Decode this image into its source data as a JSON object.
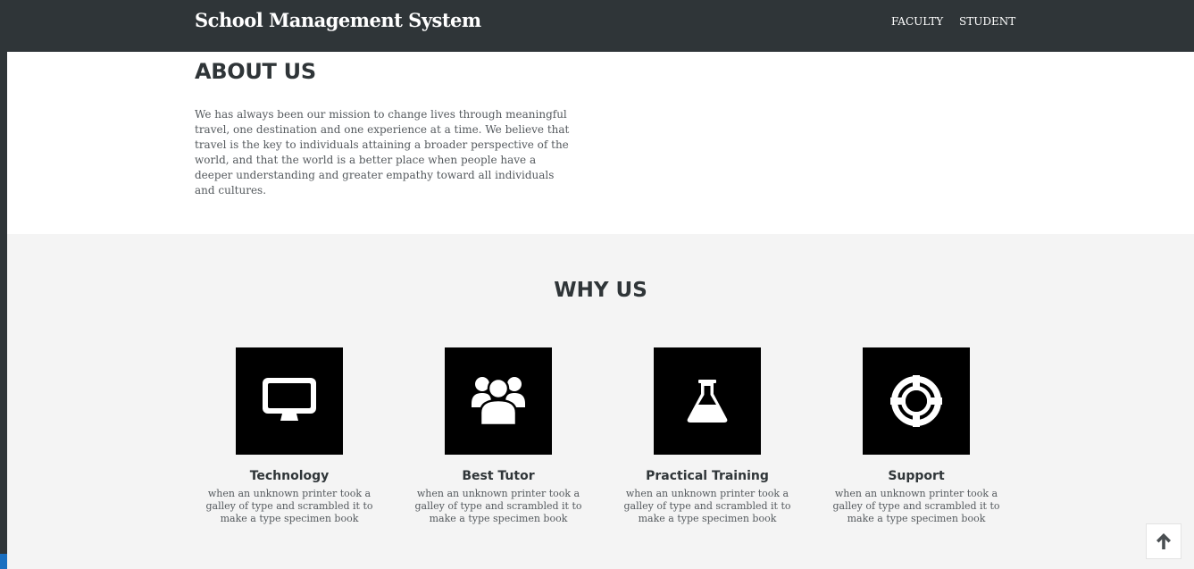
{
  "navbar": {
    "brand": "School Management System",
    "links": [
      {
        "label": "FACULTY"
      },
      {
        "label": "STUDENT"
      }
    ]
  },
  "about": {
    "title": "ABOUT US",
    "text": "We has always been our mission to change lives through meaningful travel, one destination and one experience at a time. We believe that travel is the key to individuals attaining a broader perspective of the world, and that the world is a better place when people have a deeper understanding and greater empathy toward all individuals and cultures."
  },
  "why": {
    "title": "WHY US",
    "features": [
      {
        "title": "Technology",
        "icon": "monitor-icon",
        "desc": "when an unknown printer took a galley of type and scrambled it to make a type specimen book"
      },
      {
        "title": "Best Tutor",
        "icon": "users-icon",
        "desc": "when an unknown printer took a galley of type and scrambled it to make a type specimen book"
      },
      {
        "title": "Practical Training",
        "icon": "flask-icon",
        "desc": "when an unknown printer took a galley of type and scrambled it to make a type specimen book"
      },
      {
        "title": "Support",
        "icon": "life-ring-icon",
        "desc": "when an unknown printer took a galley of type and scrambled it to make a type specimen book"
      }
    ]
  },
  "back_to_top": {
    "icon": "arrow-up-icon"
  },
  "colors": {
    "navbar_bg": "#2f3538",
    "section_bg": "#f4f4f4",
    "icon_box_bg": "#000000"
  }
}
